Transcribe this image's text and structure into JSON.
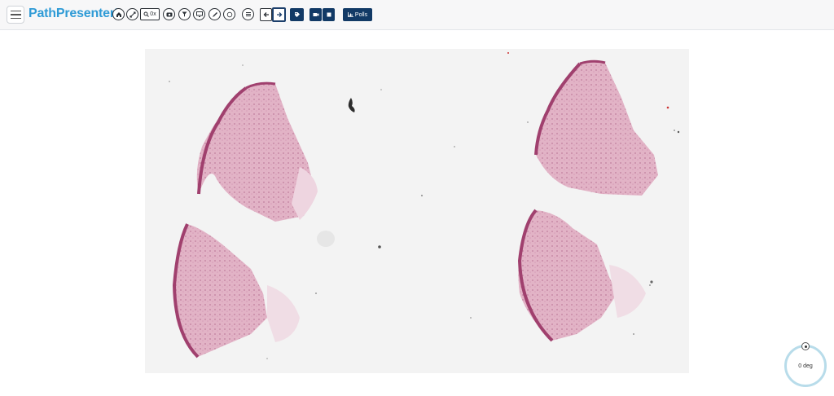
{
  "app": {
    "brand": "PathPresenter",
    "trademark": "®"
  },
  "toolbar": {
    "zoom_label": "0x",
    "polls_label": "Polls",
    "icons": [
      "home-icon",
      "fullscreen-icon",
      "zoom-icon",
      "camera-icon",
      "filter-icon",
      "monitor-icon",
      "pen-icon",
      "circle-icon",
      "list-icon",
      "arrow-left-icon",
      "arrow-right-icon",
      "tag-icon",
      "video-icon",
      "stop-icon",
      "bar-chart-icon"
    ]
  },
  "rotator": {
    "label": "0 deg"
  },
  "colors": {
    "brand": "#2f9bd6",
    "dark_button": "#123a66",
    "tissue": "#d9a8bd",
    "tissue_edge": "#a0406e"
  }
}
